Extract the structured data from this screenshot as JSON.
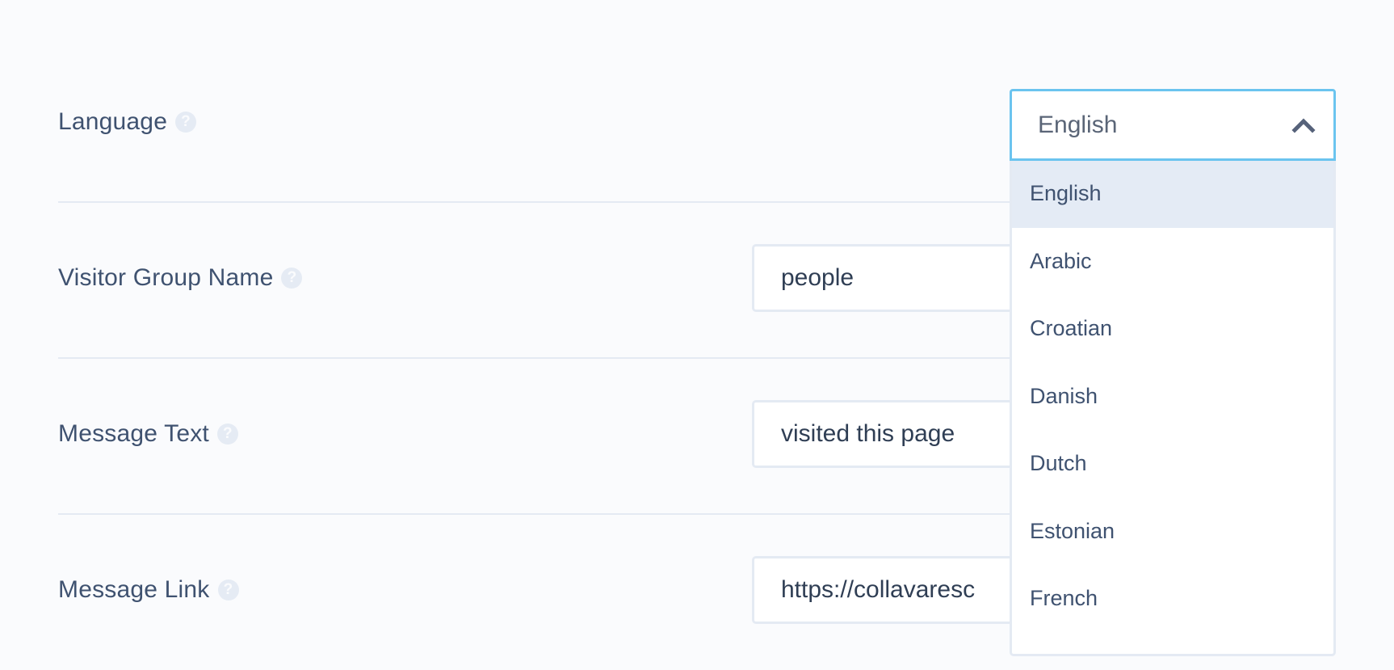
{
  "fields": [
    {
      "label": "Language",
      "help_icon": "question-circle-icon"
    },
    {
      "label": "Visitor Group Name",
      "help_icon": "question-circle-icon",
      "value": "people"
    },
    {
      "label": "Message Text",
      "help_icon": "question-circle-icon",
      "value": "visited this page"
    },
    {
      "label": "Message Link",
      "help_icon": "question-circle-icon",
      "value": "https://collavaresc"
    }
  ],
  "language_select": {
    "selected": "English",
    "expanded": true,
    "toggle_icon": "chevron-up-icon",
    "highlighted_option": "English",
    "options": [
      "English",
      "Arabic",
      "Croatian",
      "Danish",
      "Dutch",
      "Estonian",
      "French"
    ]
  },
  "help_glyph": "?",
  "colors": {
    "background": "#fafbfd",
    "focus_border": "#6bc4ef",
    "input_border": "#e4eaf3",
    "highlight": "#e4ebf5",
    "label_text": "#3f5270"
  }
}
